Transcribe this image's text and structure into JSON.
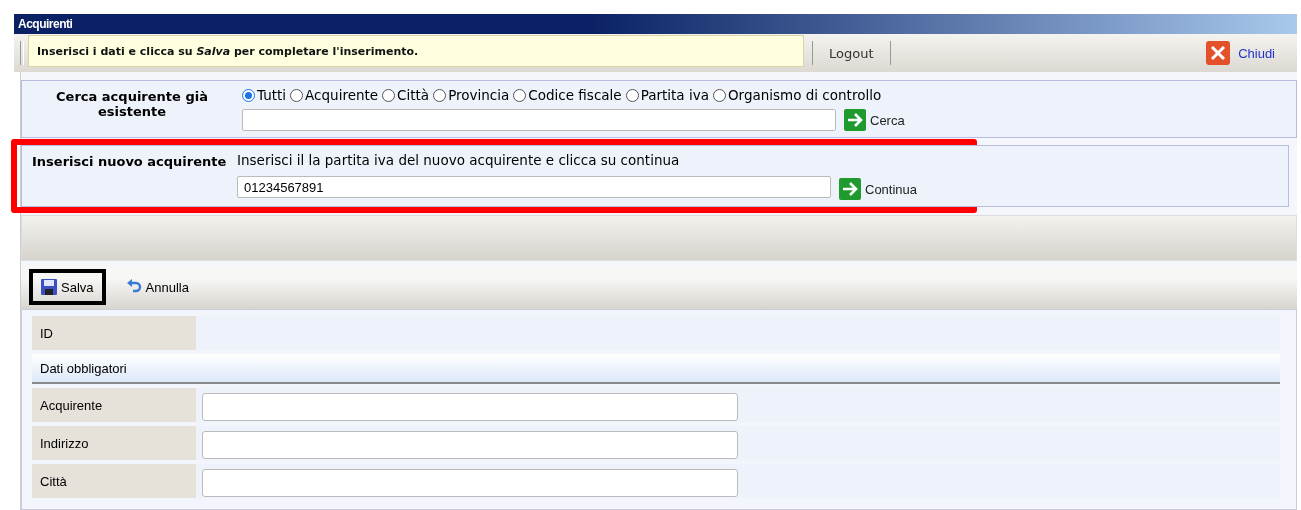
{
  "window": {
    "title": "Acquirenti"
  },
  "toolbar": {
    "message": "Inserisci i dati e clicca su *Salva* per completare l'inserimento.",
    "logout": "Logout",
    "close": "Chiudi"
  },
  "search": {
    "label": "Cerca acquirente già esistente",
    "options": [
      {
        "label": "Tutti",
        "selected": true
      },
      {
        "label": "Acquirente",
        "selected": false
      },
      {
        "label": "Città",
        "selected": false
      },
      {
        "label": "Provincia",
        "selected": false
      },
      {
        "label": "Codice fiscale",
        "selected": false
      },
      {
        "label": "Partita iva",
        "selected": false
      },
      {
        "label": "Organismo di controllo",
        "selected": false
      }
    ],
    "button": "Cerca"
  },
  "insert": {
    "label": "Inserisci nuovo acquirente",
    "hint": "Inserisci il la partita iva del nuovo acquirente e clicca su continua",
    "value": "01234567891",
    "button": "Continua",
    "highlighted": true
  },
  "actions": [
    {
      "kind": "save",
      "label": "Salva",
      "highlighted": true
    },
    {
      "kind": "undo",
      "label": "Annulla",
      "highlighted": false
    }
  ],
  "form": [
    {
      "kind": "display",
      "label": "ID"
    },
    {
      "kind": "section",
      "label": "Dati obbligatori"
    },
    {
      "kind": "field",
      "label": "Acquirente"
    },
    {
      "kind": "field",
      "label": "Indirizzo"
    },
    {
      "kind": "field",
      "label": "Città"
    }
  ]
}
